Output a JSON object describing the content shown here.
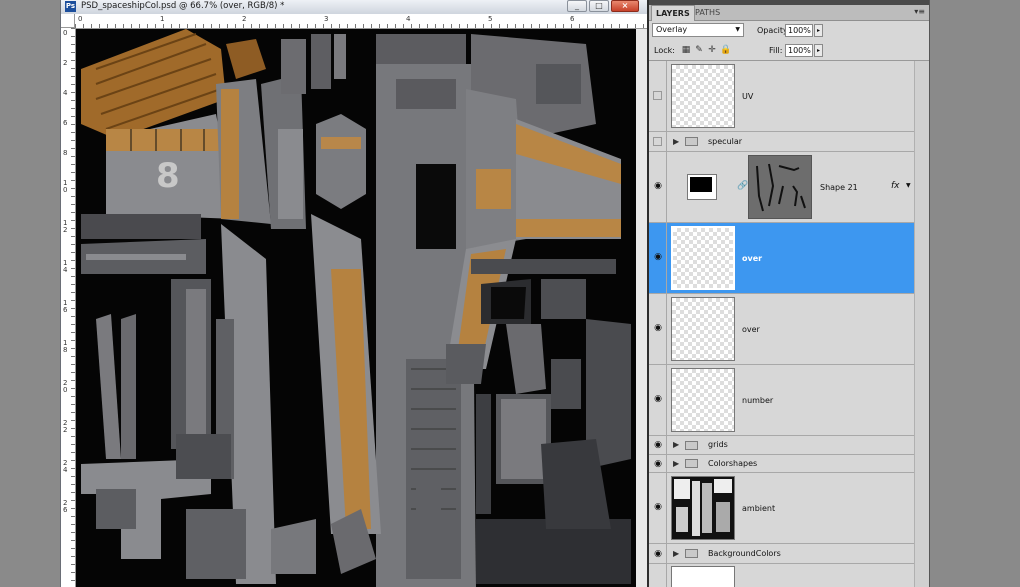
{
  "document": {
    "title": "PSD_spaceshipCol.psd @ 66.7% (over, RGB/8) *",
    "app_icon": "Ps",
    "window_buttons": {
      "minimize": "_",
      "maximize": "□",
      "close": "×"
    },
    "ruler_left_numbers": [
      "0",
      "2",
      "4",
      "6",
      "8",
      "1\n0",
      "1\n2",
      "1\n4",
      "1\n6",
      "1\n8",
      "2\n0",
      "2\n2",
      "2\n4",
      "2\n6"
    ],
    "ruler_top_numbers": [
      "0",
      "1",
      "2",
      "3",
      "4",
      "5",
      "6"
    ],
    "canvas_description": "UV texture map of spaceship hull panels",
    "canvas_label_8": "8"
  },
  "layers_panel": {
    "tabs": [
      {
        "label": "LAYERS"
      },
      {
        "label": "PATHS"
      }
    ],
    "menu_icon": "▾≡",
    "blend_mode": "Overlay",
    "opacity_label": "Opacity:",
    "opacity_value": "100%",
    "lock_label": "Lock:",
    "fill_label": "Fill:",
    "fill_value": "100%",
    "layers": [
      {
        "name": "UV",
        "visible": false,
        "type": "layer",
        "selected": false
      },
      {
        "name": "specular",
        "visible": false,
        "type": "group",
        "selected": false
      },
      {
        "name": "Shape 21",
        "visible": true,
        "type": "shape",
        "selected": false,
        "fx": "fx"
      },
      {
        "name": "over",
        "visible": true,
        "type": "layer",
        "selected": true
      },
      {
        "name": "over",
        "visible": true,
        "type": "layer",
        "selected": false
      },
      {
        "name": "number",
        "visible": true,
        "type": "layer",
        "selected": false
      },
      {
        "name": "grids",
        "visible": true,
        "type": "group",
        "selected": false
      },
      {
        "name": "Colorshapes",
        "visible": true,
        "type": "group",
        "selected": false
      },
      {
        "name": "ambient",
        "visible": true,
        "type": "layer",
        "selected": false
      },
      {
        "name": "BackgroundColors",
        "visible": true,
        "type": "group",
        "selected": false
      },
      {
        "name": "",
        "visible": false,
        "type": "layer",
        "selected": false
      }
    ]
  },
  "colors": {
    "selection": "#3d97f0",
    "panel_bg": "#d7d7d7",
    "hull_gray": "#8f9094",
    "hull_orange": "#c58f46"
  }
}
